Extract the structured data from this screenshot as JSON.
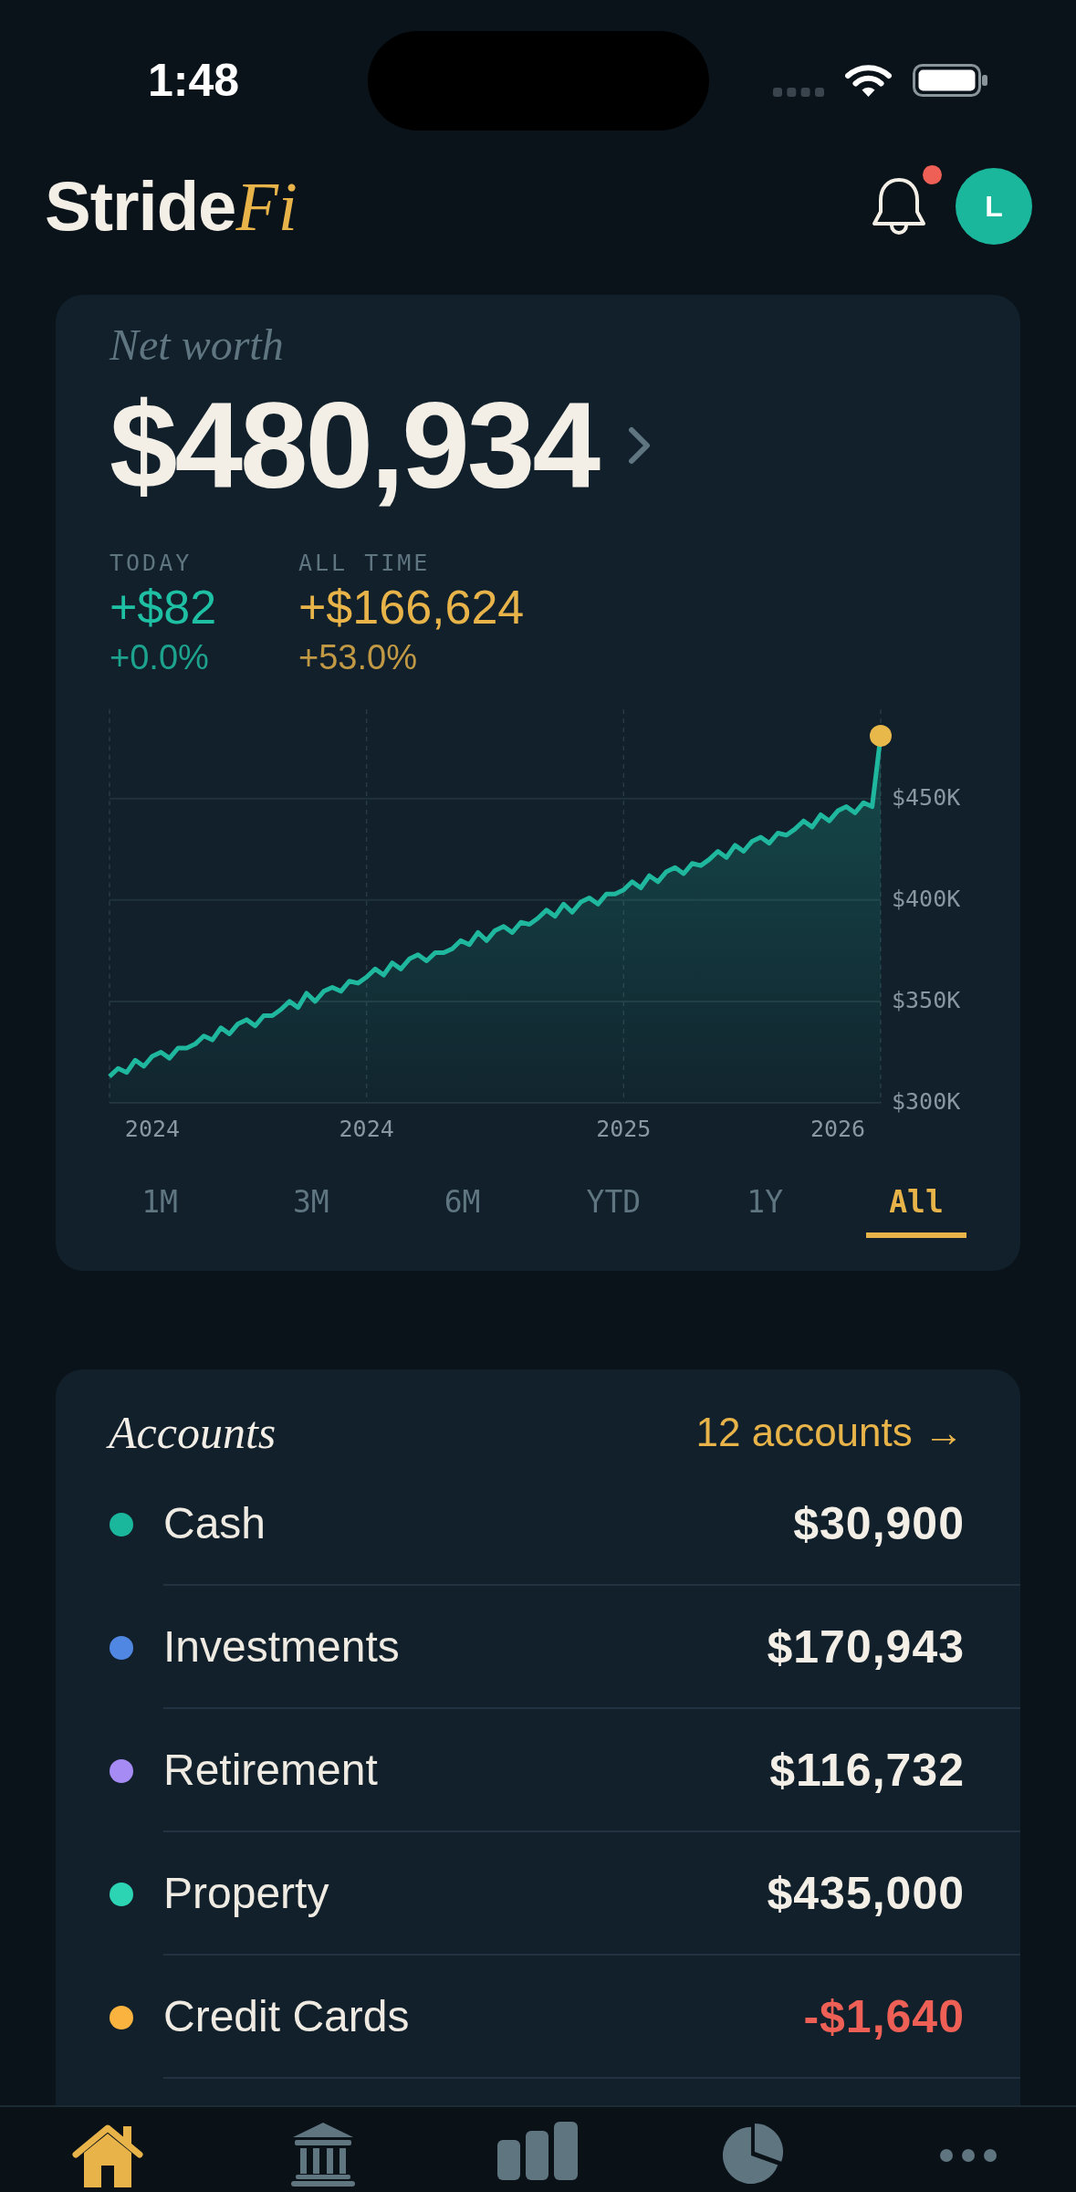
{
  "status_bar": {
    "time": "1:48"
  },
  "header": {
    "logo": {
      "text": "Stride",
      "accent": "Fi"
    },
    "notifications": {
      "unread": true
    },
    "avatar": {
      "initial": "L"
    }
  },
  "net_worth": {
    "label": "Net worth",
    "value": "$480,934",
    "stats": [
      {
        "label": "TODAY",
        "amount": "+$82",
        "percent": "+0.0%",
        "color": "#1fbfa3"
      },
      {
        "label": "ALL TIME",
        "amount": "+$166,624",
        "percent": "+53.0%",
        "color": "#e8b44a"
      }
    ],
    "chart_data": {
      "type": "area",
      "categories": [
        null,
        null,
        null,
        null,
        null,
        "2024",
        null,
        null,
        null,
        null,
        null,
        null,
        null,
        null,
        null,
        null,
        null,
        null,
        null,
        null,
        null,
        null,
        null,
        null,
        null,
        null,
        null,
        null,
        null,
        null,
        "2024",
        null,
        null,
        null,
        null,
        null,
        null,
        null,
        null,
        null,
        null,
        null,
        null,
        null,
        null,
        null,
        null,
        null,
        null,
        null,
        null,
        null,
        null,
        null,
        null,
        null,
        null,
        null,
        null,
        null,
        "2025",
        null,
        null,
        null,
        null,
        null,
        null,
        null,
        null,
        null,
        null,
        null,
        null,
        null,
        null,
        null,
        null,
        null,
        null,
        null,
        null,
        null,
        null,
        null,
        null,
        "2026",
        null,
        null,
        null,
        null,
        null
      ],
      "series": [
        {
          "color": "#1fb89e",
          "values": [
            313,
            317,
            315,
            321,
            318,
            323,
            325,
            322,
            327,
            327,
            329,
            333,
            331,
            337,
            334,
            339,
            341,
            338,
            343,
            343,
            346,
            350,
            347,
            354,
            350,
            355,
            357,
            355,
            360,
            359,
            362,
            366,
            363,
            369,
            366,
            371,
            373,
            370,
            374,
            374,
            376,
            380,
            378,
            384,
            380,
            385,
            387,
            384,
            389,
            388,
            391,
            395,
            392,
            398,
            394,
            399,
            401,
            398,
            403,
            403,
            405,
            409,
            406,
            412,
            409,
            414,
            416,
            413,
            418,
            417,
            420,
            424,
            421,
            427,
            424,
            429,
            431,
            428,
            433,
            432,
            435,
            439,
            436,
            442,
            439,
            444,
            446,
            443,
            448,
            446,
            481
          ]
        }
      ],
      "ylim": [
        300,
        494
      ],
      "yticks": [
        {
          "value": 300,
          "label": "$300K"
        },
        {
          "value": 350,
          "label": "$350K"
        },
        {
          "value": 400,
          "label": "$400K"
        },
        {
          "value": 450,
          "label": "$450K"
        }
      ],
      "grid": true
    },
    "ranges": [
      {
        "label": "1M",
        "selected": false
      },
      {
        "label": "3M",
        "selected": false
      },
      {
        "label": "6M",
        "selected": false
      },
      {
        "label": "YTD",
        "selected": false
      },
      {
        "label": "1Y",
        "selected": false
      },
      {
        "label": "All",
        "selected": true
      }
    ]
  },
  "accounts": {
    "title": "Accounts",
    "link": "12 accounts →",
    "items": [
      {
        "name": "Cash",
        "value": "$30,900",
        "color": "#1ab79d",
        "negative": false
      },
      {
        "name": "Investments",
        "value": "$170,943",
        "color": "#4f87e3",
        "negative": false
      },
      {
        "name": "Retirement",
        "value": "$116,732",
        "color": "#a68bf5",
        "negative": false
      },
      {
        "name": "Property",
        "value": "$435,000",
        "color": "#2dd4b4",
        "negative": false
      },
      {
        "name": "Credit Cards",
        "value": "-$1,640",
        "color": "#fbb33f",
        "negative": true
      }
    ]
  },
  "tab_bar": {
    "items": [
      {
        "selected": true
      },
      {
        "selected": false
      },
      {
        "selected": false
      },
      {
        "selected": false
      },
      {
        "selected": false
      }
    ]
  }
}
